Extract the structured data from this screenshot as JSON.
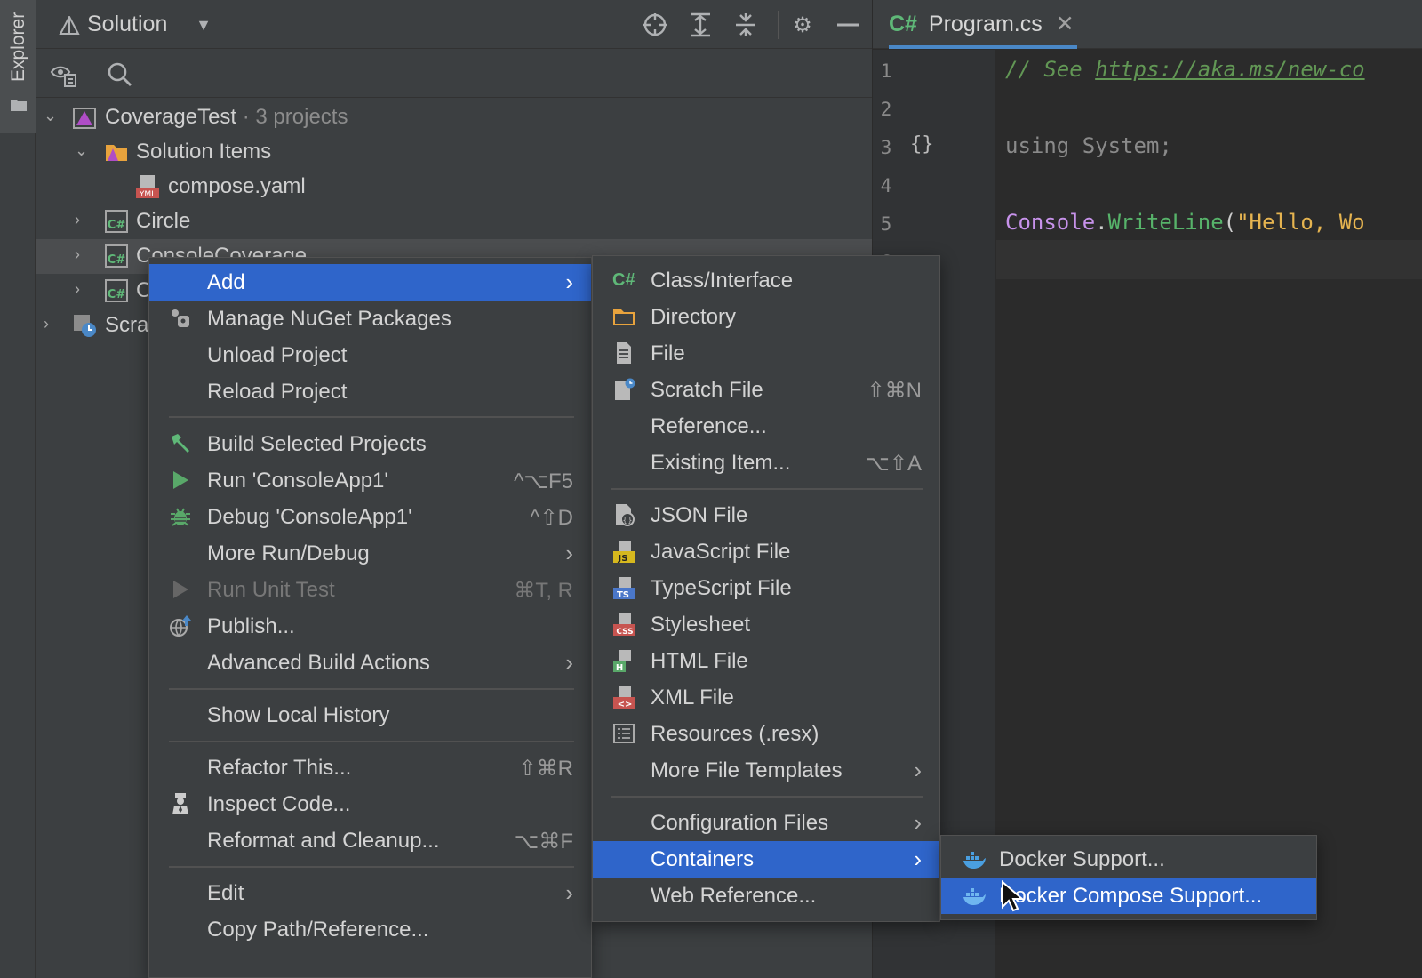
{
  "activity_bar": {
    "explorer_label": "Explorer"
  },
  "explorer": {
    "title": "Solution",
    "tree": [
      {
        "label": "CoverageTest",
        "suffix": " · 3 projects"
      },
      {
        "label": "Solution Items"
      },
      {
        "label": "compose.yaml"
      },
      {
        "label": "Circle"
      },
      {
        "label": "ConsoleCoverage"
      },
      {
        "label": "C"
      },
      {
        "label": "Scra"
      }
    ]
  },
  "editor": {
    "tab_label": "Program.cs",
    "tab_lang": "C#",
    "line_numbers": [
      "1",
      "2",
      "3",
      "4",
      "5",
      "6"
    ],
    "lines": {
      "l1_comment": "// See ",
      "l1_link": "https://aka.ms/new-co",
      "l3": "using System;",
      "l5_class": "Console",
      "l5_dot": ".",
      "l5_method": "WriteLine",
      "l5_paren": "(",
      "l5_string": "\"Hello, Wo"
    }
  },
  "context_menu": {
    "items": [
      {
        "label": "Add",
        "selected": true,
        "submenu": true
      },
      {
        "label": "Manage NuGet Packages"
      },
      {
        "label": "Unload Project"
      },
      {
        "label": "Reload Project"
      },
      {
        "label": "Build Selected Projects"
      },
      {
        "label": "Run 'ConsoleApp1'",
        "shortcut": "^⌥F5"
      },
      {
        "label": "Debug 'ConsoleApp1'",
        "shortcut": "^⇧D"
      },
      {
        "label": "More Run/Debug",
        "submenu": true
      },
      {
        "label": "Run Unit Test",
        "shortcut": "⌘T, R",
        "disabled": true
      },
      {
        "label": "Publish..."
      },
      {
        "label": "Advanced Build Actions",
        "submenu": true
      },
      {
        "label": "Show Local History"
      },
      {
        "label": "Refactor This...",
        "shortcut": "⇧⌘R"
      },
      {
        "label": "Inspect Code..."
      },
      {
        "label": "Reformat and Cleanup...",
        "shortcut": "⌥⌘F"
      },
      {
        "label": "Edit",
        "submenu": true
      },
      {
        "label": "Copy Path/Reference..."
      }
    ]
  },
  "add_submenu": {
    "items": [
      {
        "label": "Class/Interface"
      },
      {
        "label": "Directory"
      },
      {
        "label": "File"
      },
      {
        "label": "Scratch File",
        "shortcut": "⇧⌘N"
      },
      {
        "label": "Reference..."
      },
      {
        "label": "Existing Item...",
        "shortcut": "⌥⇧A"
      },
      {
        "label": "JSON File"
      },
      {
        "label": "JavaScript File"
      },
      {
        "label": "TypeScript File"
      },
      {
        "label": "Stylesheet"
      },
      {
        "label": "HTML File"
      },
      {
        "label": "XML File"
      },
      {
        "label": "Resources (.resx)"
      },
      {
        "label": "More File Templates",
        "submenu": true
      },
      {
        "label": "Configuration Files",
        "submenu": true
      },
      {
        "label": "Containers",
        "selected": true,
        "submenu": true
      },
      {
        "label": "Web Reference..."
      }
    ]
  },
  "containers_submenu": {
    "items": [
      {
        "label": "Docker Support..."
      },
      {
        "label": "Docker Compose Support...",
        "selected": true
      }
    ]
  },
  "colors": {
    "selection": "#2f65ca",
    "csharp_green": "#5fb878",
    "comment": "#629755",
    "string": "#e6b450",
    "class": "#c792ea",
    "method": "#57b36a"
  }
}
